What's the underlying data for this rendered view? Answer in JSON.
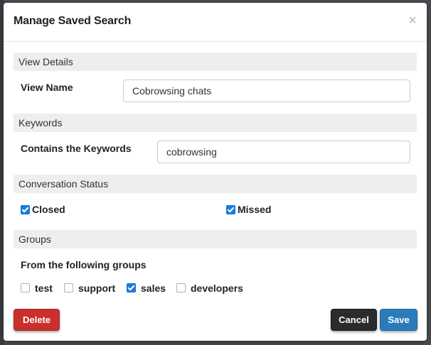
{
  "dialog": {
    "title": "Manage Saved Search",
    "close_glyph": "×"
  },
  "sections": {
    "view_details": {
      "heading": "View Details",
      "view_name_label": "View Name",
      "view_name_value": "Cobrowsing chats"
    },
    "keywords": {
      "heading": "Keywords",
      "label": "Contains the Keywords",
      "value": "cobrowsing"
    },
    "conversation_status": {
      "heading": "Conversation Status",
      "options": [
        {
          "label": "Closed",
          "checked": true
        },
        {
          "label": "Missed",
          "checked": true
        }
      ]
    },
    "groups": {
      "heading": "Groups",
      "label": "From the following groups",
      "options": [
        {
          "label": "test",
          "checked": false
        },
        {
          "label": "support",
          "checked": false
        },
        {
          "label": "sales",
          "checked": true
        },
        {
          "label": "developers",
          "checked": false
        }
      ]
    }
  },
  "footer": {
    "delete_label": "Delete",
    "cancel_label": "Cancel",
    "save_label": "Save"
  },
  "colors": {
    "delete": "#c9302c",
    "cancel": "#2b2b2b",
    "save": "#2b7bb9",
    "checkbox_checked": "#1a7ee0",
    "section_bg": "#eeeeee"
  },
  "icons": {
    "close": "close-icon",
    "checkbox_checked": "checkmark-icon"
  }
}
